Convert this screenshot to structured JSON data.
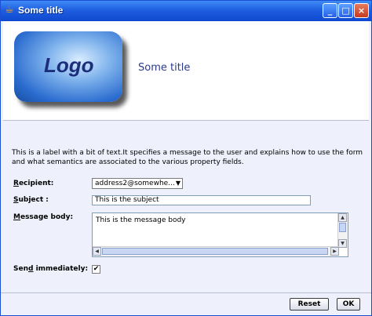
{
  "window": {
    "title": "Some title"
  },
  "header": {
    "logo_text": "Logo",
    "title": "Some title"
  },
  "description": "This is a label with a bit of text.It specifies a message to the user and explains how to use the form and what semantics are associated to the various property fields.",
  "form": {
    "recipient_label": "ecipient:",
    "recipient_mnemonic": "R",
    "recipient_value": "address2@somewhe...",
    "subject_label": "ubject :",
    "subject_mnemonic": "S",
    "subject_value": "This is the subject",
    "message_label": "essage body:",
    "message_mnemonic": "M",
    "message_value": "This is the message body",
    "send_label_pre": "Sen",
    "send_mnemonic": "d",
    "send_label_post": " immediately:",
    "send_checked": true
  },
  "buttons": {
    "reset": "Reset",
    "ok": "OK"
  }
}
